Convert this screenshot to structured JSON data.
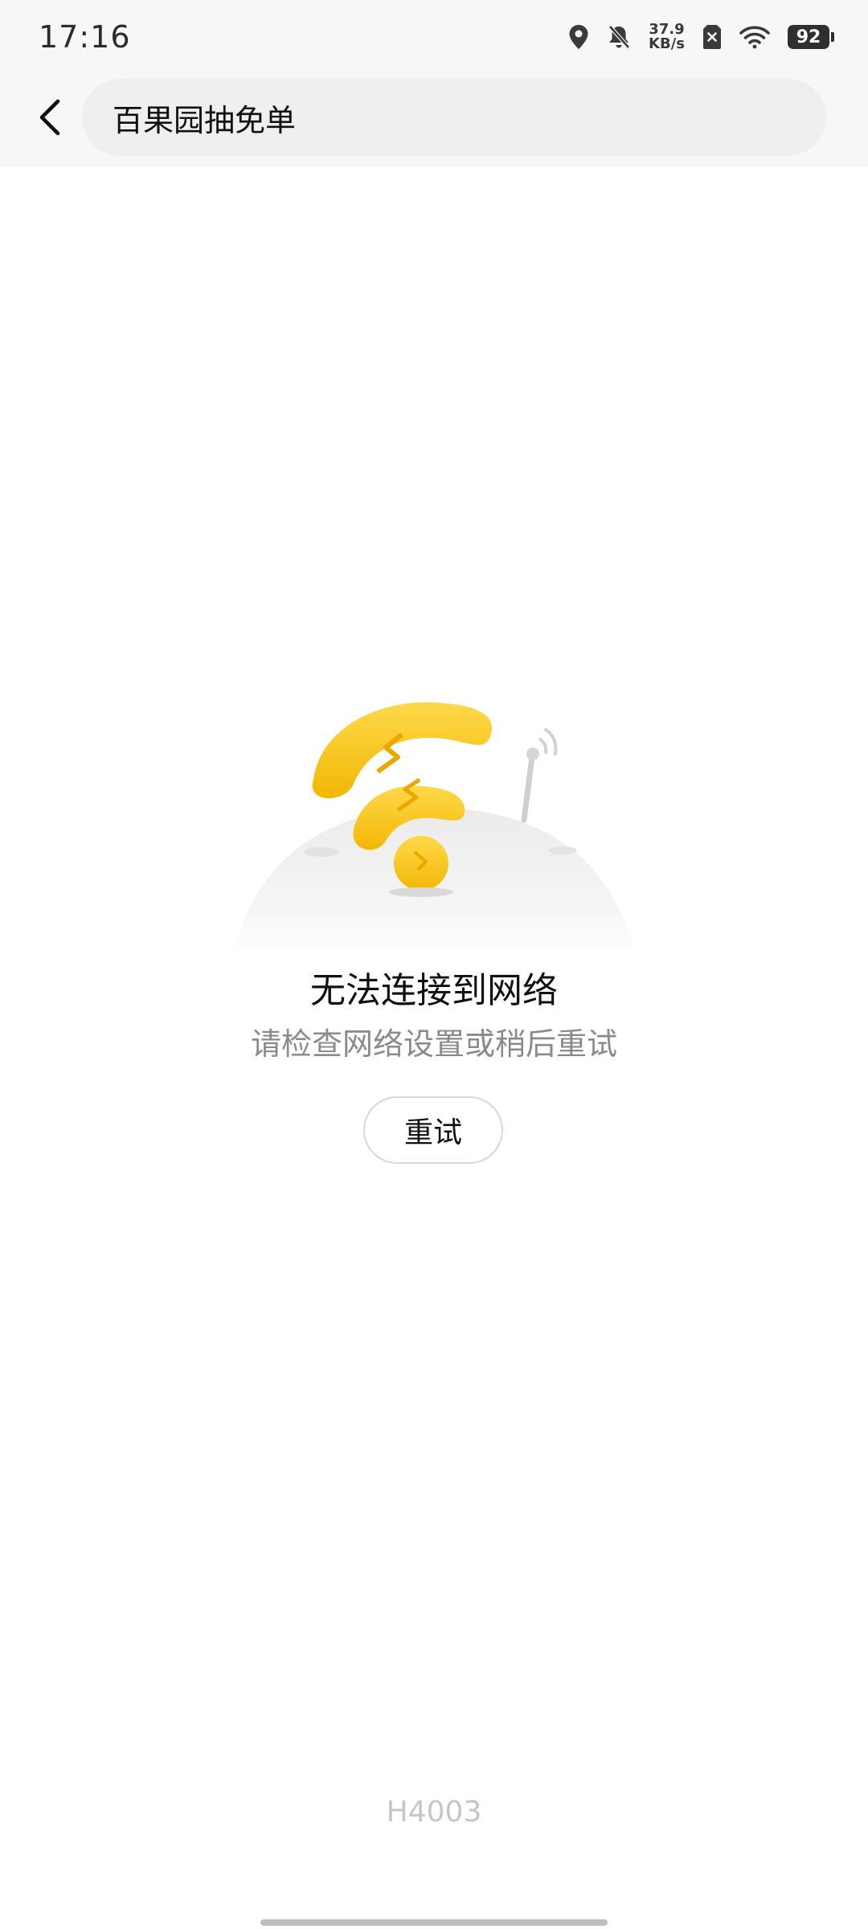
{
  "status_bar": {
    "time": "17:16",
    "net_speed_value": "37.9",
    "net_speed_unit": "KB/s",
    "battery": "92",
    "icons": [
      "location-icon",
      "bell-muted-icon",
      "sim-error-icon",
      "wifi-icon",
      "battery-icon"
    ]
  },
  "header": {
    "search_text": "百果园抽免单"
  },
  "error": {
    "title": "无法连接到网络",
    "subtitle": "请检查网络设置或稍后重试",
    "retry_label": "重试",
    "code": "H4003"
  },
  "colors": {
    "accent_yellow": "#F6C21A",
    "title_text": "#111111",
    "subtitle_text": "#8B8B8B",
    "code_text": "#C6C6C6"
  }
}
